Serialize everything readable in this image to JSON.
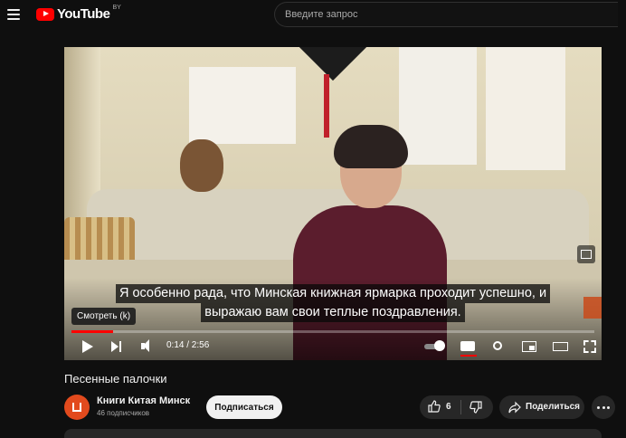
{
  "header": {
    "logo_text": "YouTube",
    "logo_region": "BY",
    "search_placeholder": "Введите запрос"
  },
  "player": {
    "caption_line1": "Я особенно рада, что Минская книжная ярмарка проходит успешно, и",
    "caption_line2": "выражаю вам свои теплые поздравления.",
    "tooltip": "Смотреть (k)",
    "time": "0:14 / 2:56",
    "progress": 0.079
  },
  "video": {
    "title": "Песенные палочки"
  },
  "channel": {
    "name": "Книги Китая Минск",
    "subscribers": "46 подписчиков",
    "subscribe_label": "Подписаться"
  },
  "actions": {
    "like_count": "6",
    "share_label": "Поделиться"
  },
  "colors": {
    "accent": "#ff0000",
    "background": "#0f0f0f",
    "channel_avatar": "#e24a1d"
  }
}
